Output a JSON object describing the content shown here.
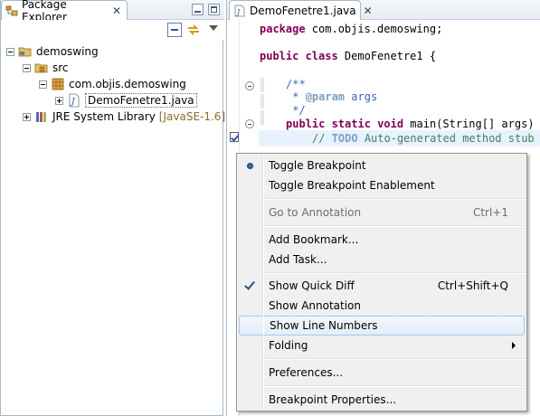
{
  "package_explorer": {
    "tab_label": "Package Explorer",
    "tree": [
      {
        "label": "demoswing",
        "decoration": ""
      },
      {
        "label": "src",
        "decoration": ""
      },
      {
        "label": "com.objis.demoswing",
        "decoration": ""
      },
      {
        "label": "DemoFenetre1.java",
        "decoration": ""
      },
      {
        "label": "JRE System Library",
        "decoration": "[JavaSE-1.6]"
      }
    ]
  },
  "editor": {
    "tab_label": "DemoFenetre1.java",
    "code": {
      "line_package_kw": "package",
      "line_package_rest": " com.objis.demoswing;",
      "line_class_kw": "public class",
      "line_class_rest": " DemoFenetre1 {",
      "javadoc_open": "/**",
      "javadoc_param_prefix": " * ",
      "javadoc_param_tag": "@param",
      "javadoc_param_rest": " args",
      "javadoc_close": " */",
      "method_kw": "public static void",
      "method_rest": " main(String[] args) {",
      "todo_prefix": "// ",
      "todo_tag": "TODO",
      "todo_rest": " Auto-generated method stub"
    }
  },
  "context_menu": {
    "items": [
      {
        "label": "Toggle Breakpoint",
        "accel": ""
      },
      {
        "label": "Toggle Breakpoint Enablement",
        "accel": ""
      },
      {
        "label": "Go to Annotation",
        "accel": "Ctrl+1"
      },
      {
        "label": "Add Bookmark...",
        "accel": ""
      },
      {
        "label": "Add Task...",
        "accel": ""
      },
      {
        "label": "Show Quick Diff",
        "accel": "Ctrl+Shift+Q"
      },
      {
        "label": "Show Annotation",
        "accel": ""
      },
      {
        "label": "Show Line Numbers",
        "accel": ""
      },
      {
        "label": "Folding",
        "accel": ""
      },
      {
        "label": "Preferences...",
        "accel": ""
      },
      {
        "label": "Breakpoint Properties...",
        "accel": ""
      }
    ]
  }
}
